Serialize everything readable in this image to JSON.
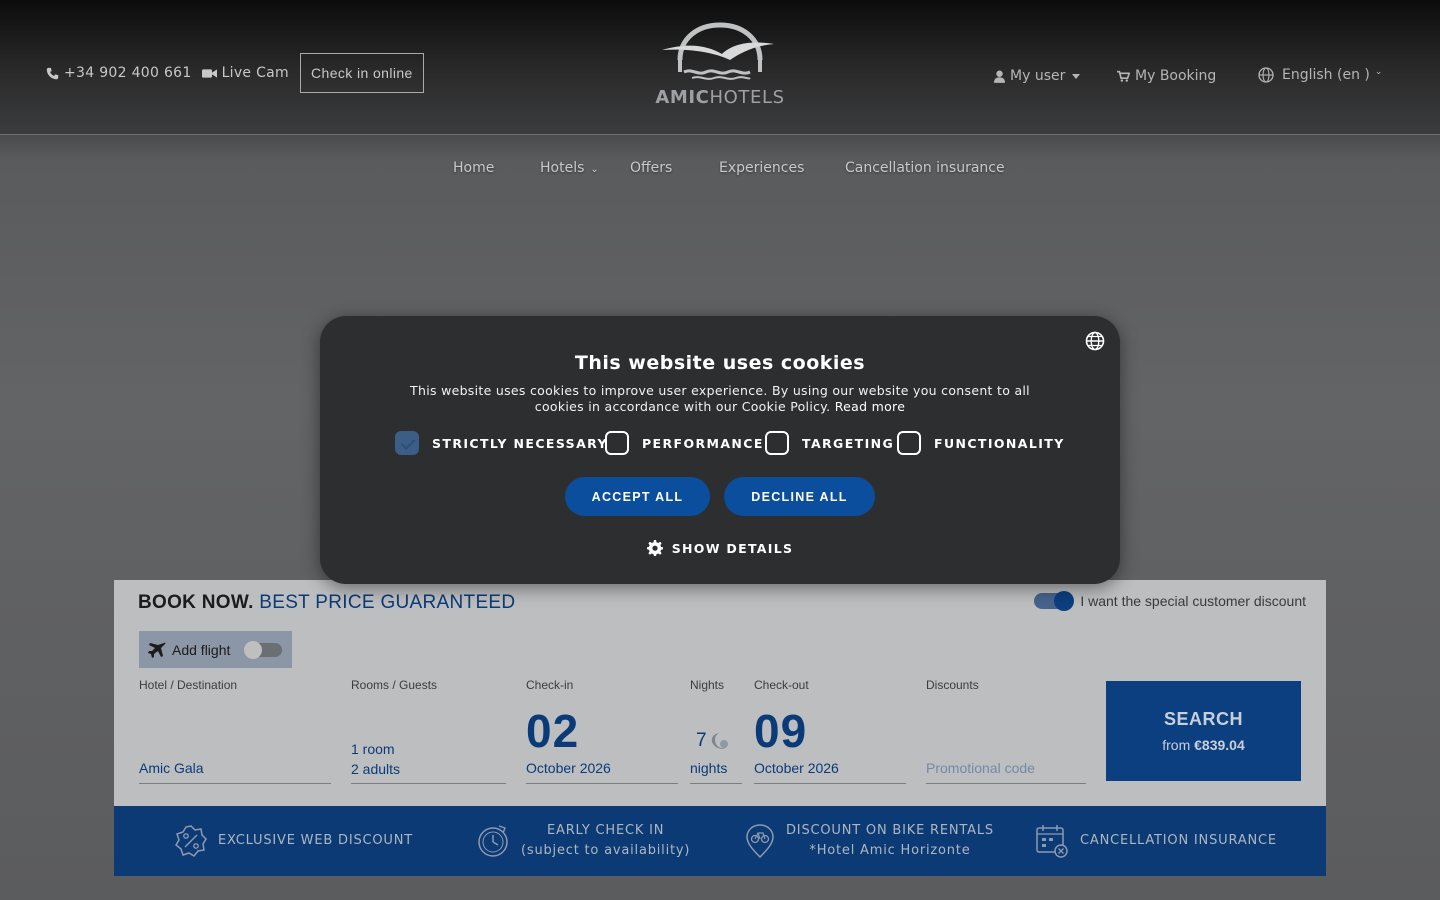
{
  "header": {
    "phone": "+34 902 400 661",
    "live_cam": "Live Cam",
    "check_in_online": "Check in online",
    "logo_bold": "AMIC",
    "logo_light": "HOTELS",
    "my_user": "My user",
    "my_booking": "My Booking",
    "language": "English (en )"
  },
  "nav": {
    "items": [
      "Home",
      "Hotels",
      "Offers",
      "Experiences",
      "Cancellation insurance"
    ]
  },
  "cookie_modal": {
    "title": "This website uses cookies",
    "text": "This website uses cookies to improve user experience. By using our website you consent to all cookies in accordance with our Cookie Policy.",
    "read_more": "Read more",
    "categories": [
      {
        "label": "STRICTLY NECESSARY",
        "checked": true
      },
      {
        "label": "PERFORMANCE",
        "checked": false
      },
      {
        "label": "TARGETING",
        "checked": false
      },
      {
        "label": "FUNCTIONALITY",
        "checked": false
      }
    ],
    "accept_all": "ACCEPT ALL",
    "decline_all": "DECLINE ALL",
    "show_details": "SHOW DETAILS"
  },
  "booking": {
    "title_bold": "BOOK NOW.",
    "title_accent": "BEST PRICE GUARANTEED",
    "special_discount": "I want the special customer discount",
    "add_flight": "Add flight",
    "hotel_label": "Hotel / Destination",
    "hotel_value": "Amic Gala",
    "rooms_label": "Rooms / Guests",
    "rooms_value": "1 room",
    "guests_value": "2 adults",
    "checkin_label": "Check-in",
    "checkin_day": "02",
    "checkin_month": "October 2026",
    "nights_label": "Nights",
    "nights_value": "7",
    "nights_word": "nights",
    "checkout_label": "Check-out",
    "checkout_day": "09",
    "checkout_month": "October 2026",
    "discounts_label": "Discounts",
    "promo_placeholder": "Promotional code",
    "search_label": "SEARCH",
    "from_label": "from",
    "from_price": "€839.04"
  },
  "benefits": [
    {
      "line1": "EXCLUSIVE WEB DISCOUNT",
      "line2": ""
    },
    {
      "line1": "EARLY CHECK IN",
      "line2": "(subject to availability)"
    },
    {
      "line1": "DISCOUNT ON BIKE RENTALS",
      "line2": "*Hotel Amic Horizonte"
    },
    {
      "line1": "CANCELLATION INSURANCE",
      "line2": ""
    }
  ]
}
